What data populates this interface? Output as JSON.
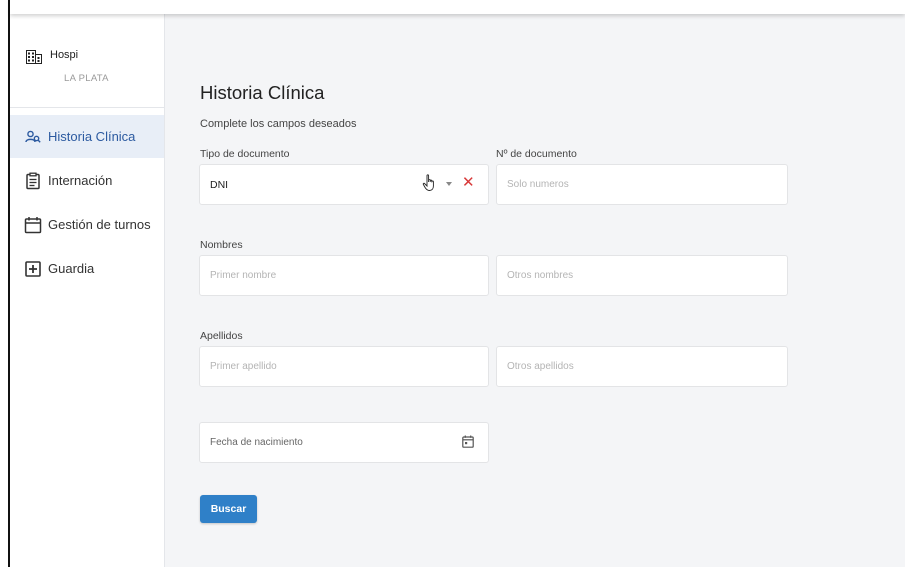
{
  "brand": {
    "name": "Hospi",
    "location": "LA PLATA"
  },
  "sidebar": {
    "items": [
      {
        "label": "Historia Clínica",
        "icon": "users-icon",
        "active": true
      },
      {
        "label": "Internación",
        "icon": "clipboard-icon"
      },
      {
        "label": "Gestión de turnos",
        "icon": "calendar-icon"
      },
      {
        "label": "Guardia",
        "icon": "plus-box-icon"
      }
    ]
  },
  "main": {
    "title": "Historia Clínica",
    "subtitle": "Complete los campos deseados",
    "doc_type": {
      "label": "Tipo de documento",
      "value": "DNI"
    },
    "doc_number": {
      "label": "Nº de documento",
      "placeholder": "Solo numeros"
    },
    "names": {
      "label": "Nombres",
      "first_placeholder": "Primer nombre",
      "other_placeholder": "Otros nombres"
    },
    "surnames": {
      "label": "Apellidos",
      "first_placeholder": "Primer apellido",
      "other_placeholder": "Otros apellidos"
    },
    "birthdate": {
      "placeholder": "Fecha de nacimiento"
    },
    "search_button": "Buscar"
  },
  "colors": {
    "accent": "#2f80c8",
    "active_bg": "#e8eef7",
    "clear": "#d83a3a"
  }
}
